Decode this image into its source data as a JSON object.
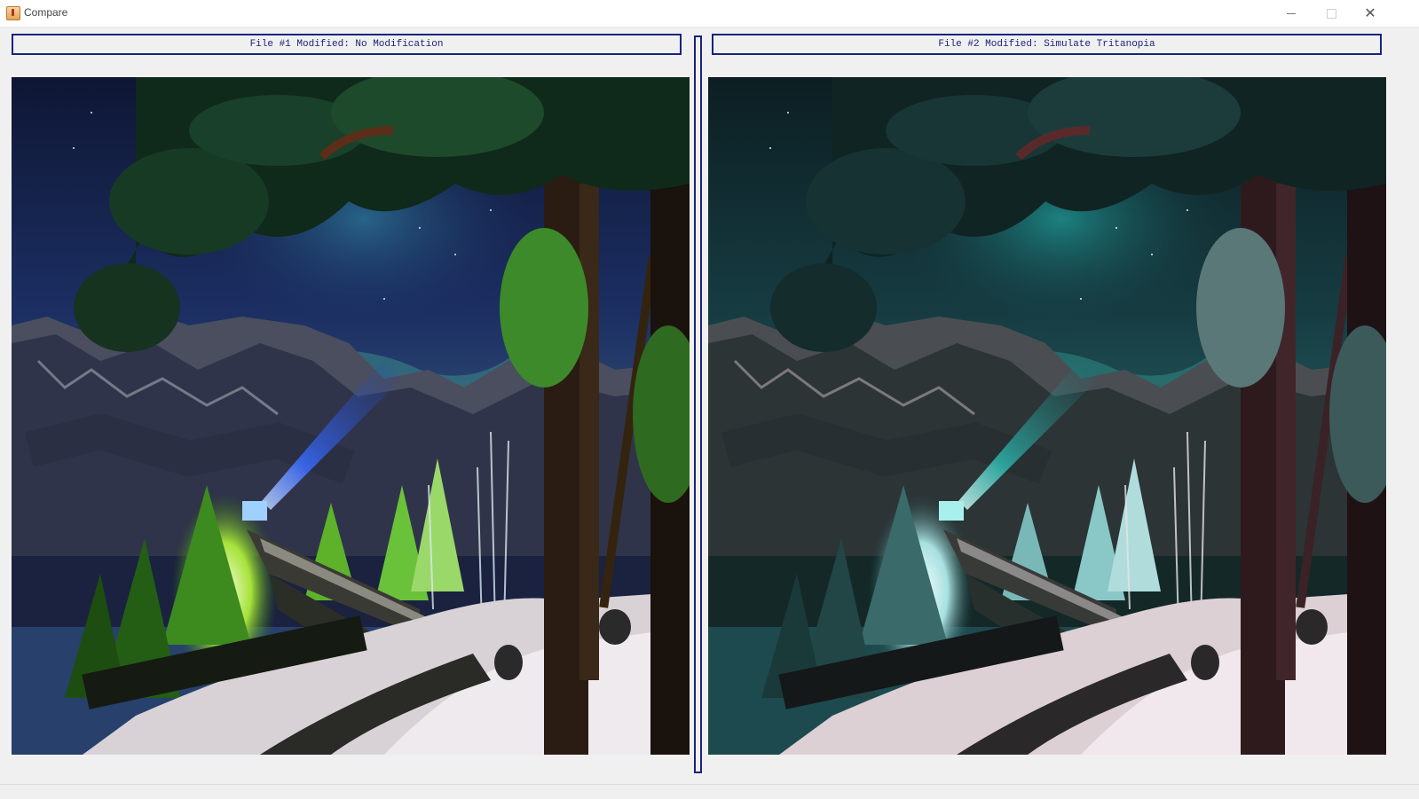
{
  "window": {
    "title": "Compare",
    "controls": [
      "minimize",
      "maximize",
      "close"
    ]
  },
  "panels": {
    "left": {
      "label": "File #1 Modified: No Modification",
      "image_description_icon": "night-landscape-image"
    },
    "right": {
      "label": "File #2 Modified: Simulate Tritanopia",
      "image_description_icon": "night-landscape-image"
    }
  },
  "colors": {
    "accent": "#1a237e",
    "background": "#f0f0f0"
  }
}
